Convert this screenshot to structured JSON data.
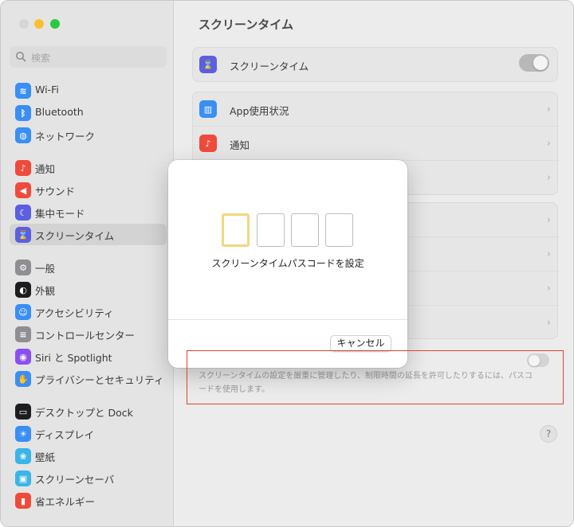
{
  "window": {
    "title": "スクリーンタイム"
  },
  "sidebar": {
    "search_placeholder": "検索",
    "items": [
      {
        "label": "Wi-Fi",
        "icon": "wifi-icon",
        "color": "#3a8ef5",
        "glyph": "≋"
      },
      {
        "label": "Bluetooth",
        "icon": "bluetooth-icon",
        "color": "#3a8ef5",
        "glyph": "ᛒ"
      },
      {
        "label": "ネットワーク",
        "icon": "globe-icon",
        "color": "#3a8ef5",
        "glyph": "◍"
      },
      {
        "label": "通知",
        "icon": "bell-icon",
        "color": "#ef4b3c",
        "glyph": "♪"
      },
      {
        "label": "サウンド",
        "icon": "speaker-icon",
        "color": "#ef4b3c",
        "glyph": "◀"
      },
      {
        "label": "集中モード",
        "icon": "moon-icon",
        "color": "#5b5fe0",
        "glyph": "☾"
      },
      {
        "label": "スクリーンタイム",
        "icon": "hourglass-icon",
        "color": "#5b5fe0",
        "glyph": "⌛"
      },
      {
        "label": "一般",
        "icon": "gear-icon",
        "color": "#8e8e93",
        "glyph": "⚙"
      },
      {
        "label": "外観",
        "icon": "appearance-icon",
        "color": "#1d1d1f",
        "glyph": "◐"
      },
      {
        "label": "アクセシビリティ",
        "icon": "accessibility-icon",
        "color": "#3a8ef5",
        "glyph": "☺"
      },
      {
        "label": "コントロールセンター",
        "icon": "control-center-icon",
        "color": "#8e8e93",
        "glyph": "≡"
      },
      {
        "label": "Siri と Spotlight",
        "icon": "siri-icon",
        "color": "#8a4ff0",
        "glyph": "◉"
      },
      {
        "label": "プライバシーとセキュリティ",
        "icon": "hand-icon",
        "color": "#3a8ef5",
        "glyph": "✋"
      },
      {
        "label": "デスクトップと Dock",
        "icon": "dock-icon",
        "color": "#1d1d1f",
        "glyph": "▭"
      },
      {
        "label": "ディスプレイ",
        "icon": "display-icon",
        "color": "#3a8ef5",
        "glyph": "☀"
      },
      {
        "label": "壁紙",
        "icon": "wallpaper-icon",
        "color": "#39b5e8",
        "glyph": "❀"
      },
      {
        "label": "スクリーンセーバ",
        "icon": "screensaver-icon",
        "color": "#39b5e8",
        "glyph": "▣"
      },
      {
        "label": "省エネルギー",
        "icon": "battery-icon",
        "color": "#ef4b3c",
        "glyph": "▮"
      }
    ]
  },
  "main": {
    "title": "スクリーンタイム",
    "screen_time_row": {
      "label": "スクリーンタイム",
      "icon": "hourglass-icon",
      "toggle_on": true
    },
    "rows": [
      {
        "label": "App使用状況",
        "icon": "chart-icon",
        "color": "#3a8ef5"
      },
      {
        "label": "通知",
        "icon": "bell-icon",
        "color": "#ef4b3c"
      }
    ],
    "description": "スクリーンタイムの設定を厳重に管理したり、制限時間の延長を許可したりするには、パスコードを使用します。",
    "passcode_toggle_on": false,
    "help_label": "?"
  },
  "dialog": {
    "title": "スクリーンタイムパスコードを設定",
    "cancel_label": "キャンセル",
    "digit_count": 4
  },
  "colors": {
    "highlight": "#e4412c",
    "active_digit": "#f2d77e"
  }
}
